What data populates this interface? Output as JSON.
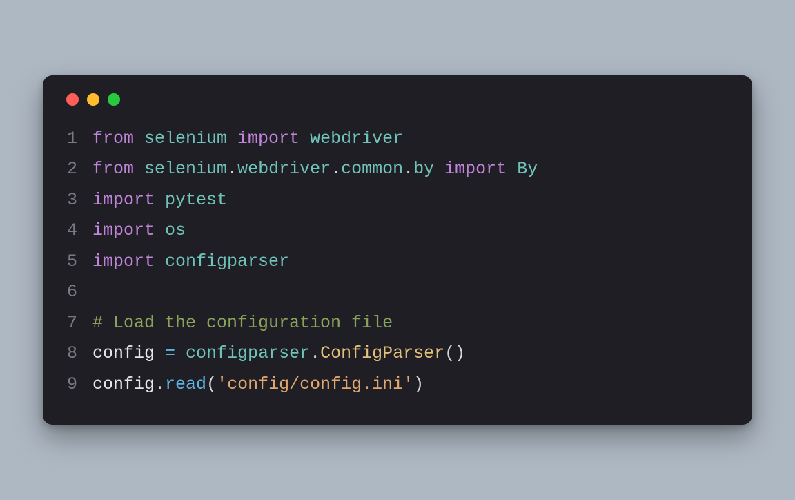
{
  "window": {
    "traffic_lights": [
      "close",
      "minimize",
      "zoom"
    ]
  },
  "code": {
    "lines": [
      {
        "n": "1",
        "tokens": [
          {
            "t": "from ",
            "c": "kw"
          },
          {
            "t": "selenium ",
            "c": "mod"
          },
          {
            "t": "import ",
            "c": "kw"
          },
          {
            "t": "webdriver",
            "c": "mod"
          }
        ]
      },
      {
        "n": "2",
        "tokens": [
          {
            "t": "from ",
            "c": "kw"
          },
          {
            "t": "selenium",
            "c": "mod"
          },
          {
            "t": ".",
            "c": "pl"
          },
          {
            "t": "webdriver",
            "c": "mod"
          },
          {
            "t": ".",
            "c": "pl"
          },
          {
            "t": "common",
            "c": "mod"
          },
          {
            "t": ".",
            "c": "pl"
          },
          {
            "t": "by ",
            "c": "mod"
          },
          {
            "t": "import ",
            "c": "kw"
          },
          {
            "t": "By",
            "c": "mod"
          }
        ]
      },
      {
        "n": "3",
        "tokens": [
          {
            "t": "import ",
            "c": "kw"
          },
          {
            "t": "pytest",
            "c": "mod"
          }
        ]
      },
      {
        "n": "4",
        "tokens": [
          {
            "t": "import ",
            "c": "kw"
          },
          {
            "t": "os",
            "c": "mod"
          }
        ]
      },
      {
        "n": "5",
        "tokens": [
          {
            "t": "import ",
            "c": "kw"
          },
          {
            "t": "configparser",
            "c": "mod"
          }
        ]
      },
      {
        "n": "6",
        "tokens": [
          {
            "t": " ",
            "c": "pl"
          }
        ]
      },
      {
        "n": "7",
        "tokens": [
          {
            "t": "# Load the configuration file",
            "c": "cmt"
          }
        ]
      },
      {
        "n": "8",
        "tokens": [
          {
            "t": "config ",
            "c": "var"
          },
          {
            "t": "= ",
            "c": "op"
          },
          {
            "t": "configparser",
            "c": "mod"
          },
          {
            "t": ".",
            "c": "pl"
          },
          {
            "t": "ConfigParser",
            "c": "cls"
          },
          {
            "t": "()",
            "c": "pl"
          }
        ]
      },
      {
        "n": "9",
        "tokens": [
          {
            "t": "config",
            "c": "var"
          },
          {
            "t": ".",
            "c": "pl"
          },
          {
            "t": "read",
            "c": "fn"
          },
          {
            "t": "(",
            "c": "pl"
          },
          {
            "t": "'config/config.ini'",
            "c": "str"
          },
          {
            "t": ")",
            "c": "pl"
          }
        ]
      }
    ]
  }
}
